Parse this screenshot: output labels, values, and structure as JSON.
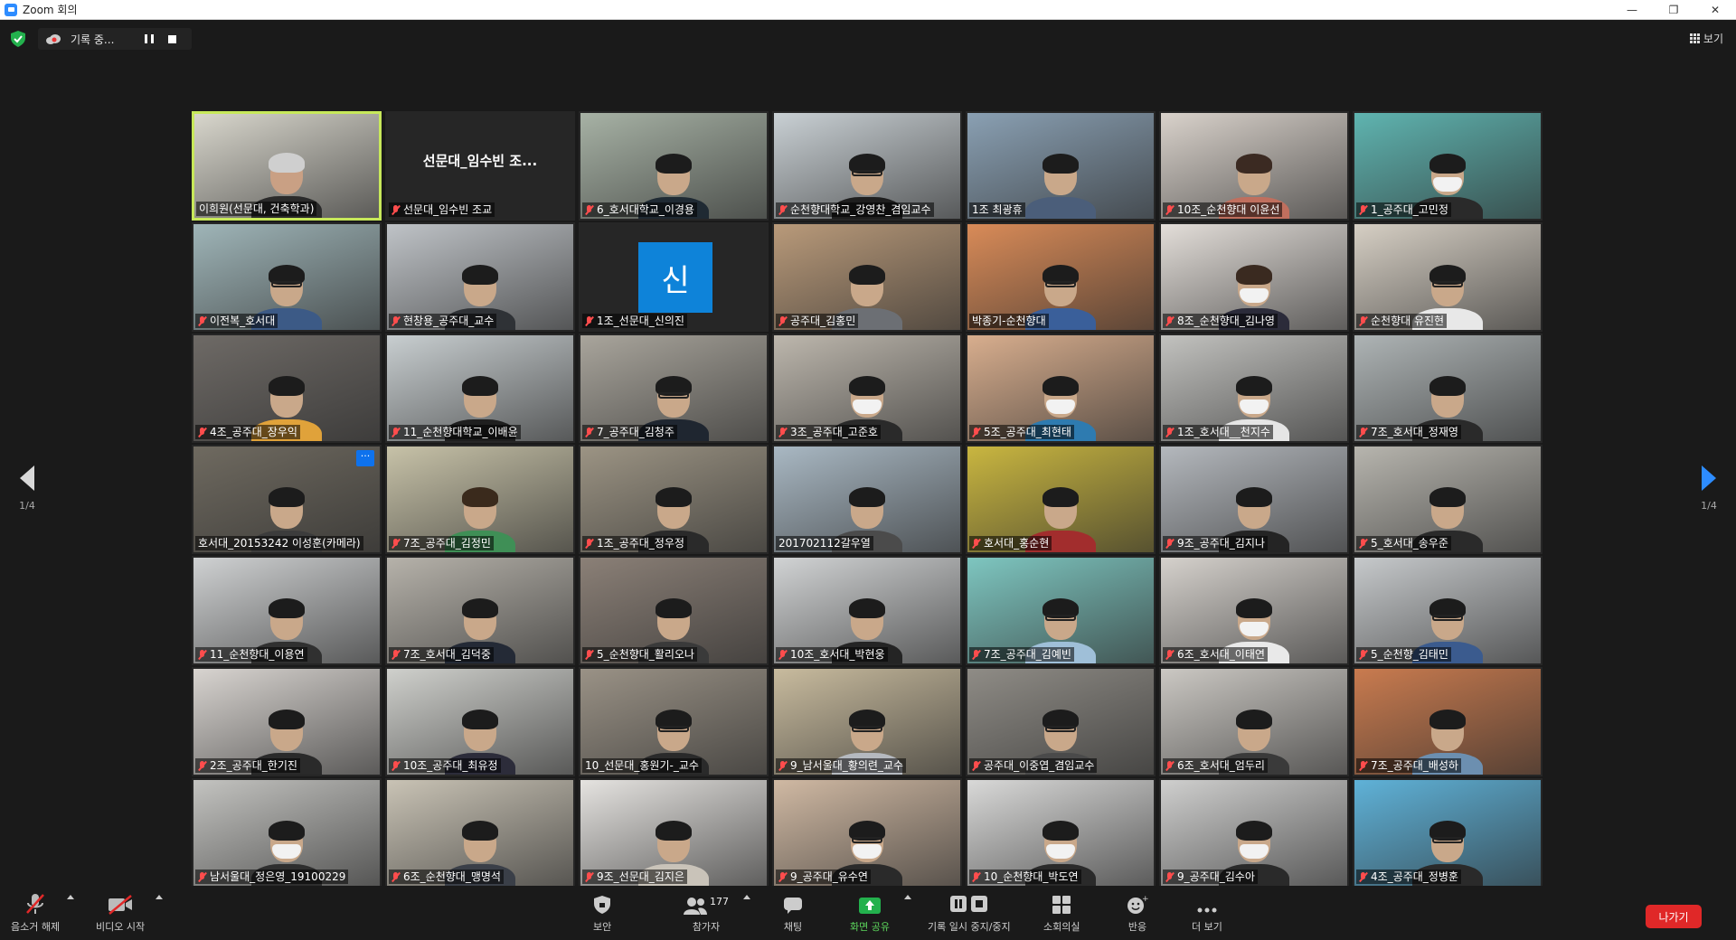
{
  "window": {
    "title": "Zoom 회의"
  },
  "topbar": {
    "recording_text": "기록 중...",
    "view_label": "보기"
  },
  "pagination": {
    "left": "1/4",
    "right": "1/4"
  },
  "participants": [
    {
      "name": "이희원(선문대, 건축학과)",
      "muted": false,
      "active": true,
      "bg": "#d8d6cc",
      "hair": "#cfcfcf",
      "body": "#2a2a2a",
      "skin": "#c9a084"
    },
    {
      "name": "선문대_임수빈 조교",
      "muted": true,
      "display": "선문대_임수빈 조...",
      "bg": "#262626"
    },
    {
      "name": "6_호서대학교_이경용",
      "muted": true,
      "bg": "#a7b2a5",
      "body": "#1f2a33"
    },
    {
      "name": "순천향대학교_강영찬_겸임교수",
      "muted": true,
      "bg": "#c9d0d4",
      "body": "#1e1e1e",
      "glasses": true
    },
    {
      "name": "1조 최광휴",
      "muted": false,
      "bg": "#8aa0b3",
      "body": "#4b5e7a"
    },
    {
      "name": "10조_순천향대 이윤선",
      "muted": true,
      "bg": "#d9d2cb",
      "body": "#c06f5e",
      "hair": "#3b2a22"
    },
    {
      "name": "1_공주대_고민정",
      "muted": true,
      "bg": "#5fb4b0",
      "body": "#2a2a2a",
      "mask": true
    },
    {
      "name": "이전복_호서대",
      "muted": true,
      "bg": "#9fb5b8",
      "body": "#3c5a86",
      "glasses": true
    },
    {
      "name": "현창용_공주대_교수",
      "muted": true,
      "bg": "#bfc3c7",
      "body": "#2f3236"
    },
    {
      "name": "1조_선문대_신의진",
      "muted": true,
      "avatar": "신",
      "bg": "#262626"
    },
    {
      "name": "공주대_김홍민",
      "muted": true,
      "bg": "#b99a7a",
      "body": "#6c6f74"
    },
    {
      "name": "박종기-순천향대",
      "muted": false,
      "bg": "#d98b58",
      "body": "#3a5f9a",
      "glasses": true
    },
    {
      "name": "8조_순천향대_김나영",
      "muted": true,
      "bg": "#e3ded9",
      "body": "#2b2b3a",
      "mask": true,
      "hair": "#3a2a20"
    },
    {
      "name": "순천향대 유진현",
      "muted": true,
      "bg": "#d6cfc4",
      "body": "#e8e8e8",
      "glasses": true
    },
    {
      "name": "4조_공주대_장우익",
      "muted": true,
      "bg": "#6e6a66",
      "body": "#e0a23a"
    },
    {
      "name": "11_순천향대학교_이배윤",
      "muted": true,
      "bg": "#c8ced0",
      "body": "#1f1f1f"
    },
    {
      "name": "7_공주대_김청주",
      "muted": true,
      "bg": "#a9a59c",
      "body": "#1f2630",
      "glasses": true
    },
    {
      "name": "3조_공주대_고준호",
      "muted": true,
      "bg": "#bdb7ad",
      "body": "#2a2a2a",
      "mask": true
    },
    {
      "name": "5조_공주대_최현태",
      "muted": true,
      "bg": "#d8ae8e",
      "body": "#2e7bb0",
      "mask": true
    },
    {
      "name": "1조_호서대__천지수",
      "muted": true,
      "bg": "#c2c2bf",
      "body": "#e5e5e5",
      "mask": true
    },
    {
      "name": "7조_호서대_정재영",
      "muted": true,
      "bg": "#aeb4b5",
      "body": "#2a2a2a"
    },
    {
      "name": "호서대_20153242 이성훈(카메라)",
      "muted": false,
      "more": true,
      "bg": "#6f6a60",
      "body": "#3c3c3c"
    },
    {
      "name": "7조_공주대_김정민",
      "muted": true,
      "bg": "#c7c2a8",
      "body": "#3f8f56",
      "hair": "#3a2a1c"
    },
    {
      "name": "1조_공주대_정우정",
      "muted": true,
      "bg": "#9c9484",
      "body": "#2a2a2a"
    },
    {
      "name": "201702112갈우열",
      "muted": false,
      "bg": "#a9b8c3",
      "body": "#4b4b4b"
    },
    {
      "name": "호서대_홍순현",
      "muted": true,
      "bg": "#c9b640",
      "body": "#a22d2d"
    },
    {
      "name": "9조_공주대_김지나",
      "muted": true,
      "bg": "#b4b8bd",
      "body": "#242424"
    },
    {
      "name": "5_호서대_송우준",
      "muted": true,
      "bg": "#b7b5ae",
      "body": "#2a2a2a"
    },
    {
      "name": "11_순천향대_이용연",
      "muted": true,
      "bg": "#cfd1d2",
      "body": "#303030"
    },
    {
      "name": "7조_호서대_김덕중",
      "muted": true,
      "bg": "#b6b2aa",
      "body": "#242a36"
    },
    {
      "name": "5_순천향대_활리오나",
      "muted": true,
      "bg": "#8b8077",
      "body": "#3a3a3a"
    },
    {
      "name": "10조_호서대_박현웅",
      "muted": true,
      "bg": "#d1d3d4",
      "body": "#242424"
    },
    {
      "name": "7조_공주대_김예빈",
      "muted": true,
      "bg": "#7ec6c0",
      "body": "#9fbfd8",
      "glasses": true
    },
    {
      "name": "6조_호서대_이태연",
      "muted": true,
      "bg": "#d5d1cc",
      "body": "#e9e9e9",
      "mask": true
    },
    {
      "name": "5_순천향_김태민",
      "muted": true,
      "bg": "#c6c9cb",
      "body": "#3b5b8e",
      "glasses": true
    },
    {
      "name": "2조_공주대_한기진",
      "muted": true,
      "bg": "#d8d4d0",
      "body": "#2a2a2a"
    },
    {
      "name": "10조_공주대_최유정",
      "muted": true,
      "bg": "#cfd0cc",
      "body": "#2c2c3a",
      "hair": "#1c1c1c"
    },
    {
      "name": "10_선문대_홍원기-_교수",
      "muted": false,
      "bg": "#9a9286",
      "body": "#2a2a2a",
      "glasses": true
    },
    {
      "name": "9_남서울대_황의련_교수",
      "muted": true,
      "bg": "#c8bb9e",
      "body": "#b5b9bf",
      "glasses": true
    },
    {
      "name": "공주대_이중엽_겸임교수",
      "muted": true,
      "bg": "#8f8c86",
      "body": "#4a4a4a",
      "glasses": true
    },
    {
      "name": "6조_호서대_엄두리",
      "muted": true,
      "bg": "#cbc8c3",
      "body": "#3a3a3a"
    },
    {
      "name": "7조_공주대_배성하",
      "muted": true,
      "bg": "#c97b4f",
      "body": "#6c8fb0"
    },
    {
      "name": "남서울대_정은영_19100229",
      "muted": true,
      "bg": "#c3c3c0",
      "body": "#2e2e2e",
      "mask": true
    },
    {
      "name": "6조_순천향대_맹명석",
      "muted": true,
      "bg": "#c9c3b5",
      "body": "#3a3f48"
    },
    {
      "name": "9조_선문대_김지은",
      "muted": true,
      "bg": "#e5e3e0",
      "body": "#c9c3b9"
    },
    {
      "name": "9_공주대_유수연",
      "muted": true,
      "bg": "#d0b9a3",
      "body": "#2a2a2a",
      "mask": true,
      "glasses": true
    },
    {
      "name": "10_순천향대_박도연",
      "muted": true,
      "bg": "#d9d9d8",
      "body": "#2a2a2a",
      "mask": true
    },
    {
      "name": "9_공주대_김수아",
      "muted": true,
      "bg": "#cfcfce",
      "body": "#2a2a2a",
      "mask": true
    },
    {
      "name": "4조_공주대_정병훈",
      "muted": true,
      "bg": "#5fb2d8",
      "body": "#2a2a2a",
      "glasses": true
    }
  ],
  "toolbar": {
    "unmute": "음소거 해제",
    "start_video": "비디오 시작",
    "security": "보안",
    "participants": "참가자",
    "participant_count": "177",
    "chat": "채팅",
    "share_screen": "화면 공유",
    "record_pause_stop": "기록 일시 중지/중지",
    "breakout_rooms": "소회의실",
    "reactions": "반응",
    "more": "더 보기",
    "leave": "나가기"
  },
  "colors": {
    "accent": "#2d8cff",
    "share_green": "#5cd65c",
    "leave_red": "#e02828",
    "muted_red": "#ff4d4d",
    "active_border": "#c7e85a"
  }
}
